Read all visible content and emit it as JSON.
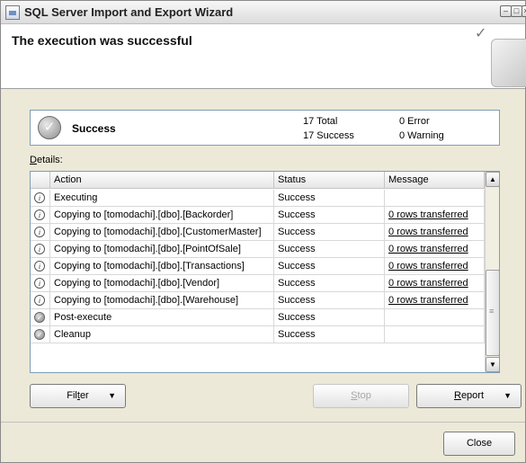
{
  "window": {
    "title": "SQL Server Import and Export Wizard"
  },
  "header": {
    "title": "The execution was successful"
  },
  "summary": {
    "status": "Success",
    "total": "17 Total",
    "success": "17 Success",
    "error": "0 Error",
    "warning": "0 Warning"
  },
  "details": {
    "label": "Details:",
    "columns": [
      "Action",
      "Status",
      "Message"
    ],
    "rows": [
      {
        "icon": "info-icon",
        "action": "Executing",
        "status": "Success",
        "message": ""
      },
      {
        "icon": "info-icon",
        "action": "Copying to [tomodachi].[dbo].[Backorder]",
        "status": "Success",
        "message": "0 rows transferred"
      },
      {
        "icon": "info-icon",
        "action": "Copying to [tomodachi].[dbo].[CustomerMaster]",
        "status": "Success",
        "message": "0 rows transferred"
      },
      {
        "icon": "info-icon",
        "action": "Copying to [tomodachi].[dbo].[PointOfSale]",
        "status": "Success",
        "message": "0 rows transferred"
      },
      {
        "icon": "info-icon",
        "action": "Copying to [tomodachi].[dbo].[Transactions]",
        "status": "Success",
        "message": "0 rows transferred"
      },
      {
        "icon": "info-icon",
        "action": "Copying to [tomodachi].[dbo].[Vendor]",
        "status": "Success",
        "message": "0 rows transferred"
      },
      {
        "icon": "info-icon",
        "action": "Copying to [tomodachi].[dbo].[Warehouse]",
        "status": "Success",
        "message": "0 rows transferred"
      },
      {
        "icon": "success-icon",
        "action": "Post-execute",
        "status": "Success",
        "message": ""
      },
      {
        "icon": "success-icon",
        "action": "Cleanup",
        "status": "Success",
        "message": ""
      }
    ]
  },
  "buttons": {
    "filter": "Filter",
    "stop": "Stop",
    "report": "Report",
    "close": "Close"
  }
}
